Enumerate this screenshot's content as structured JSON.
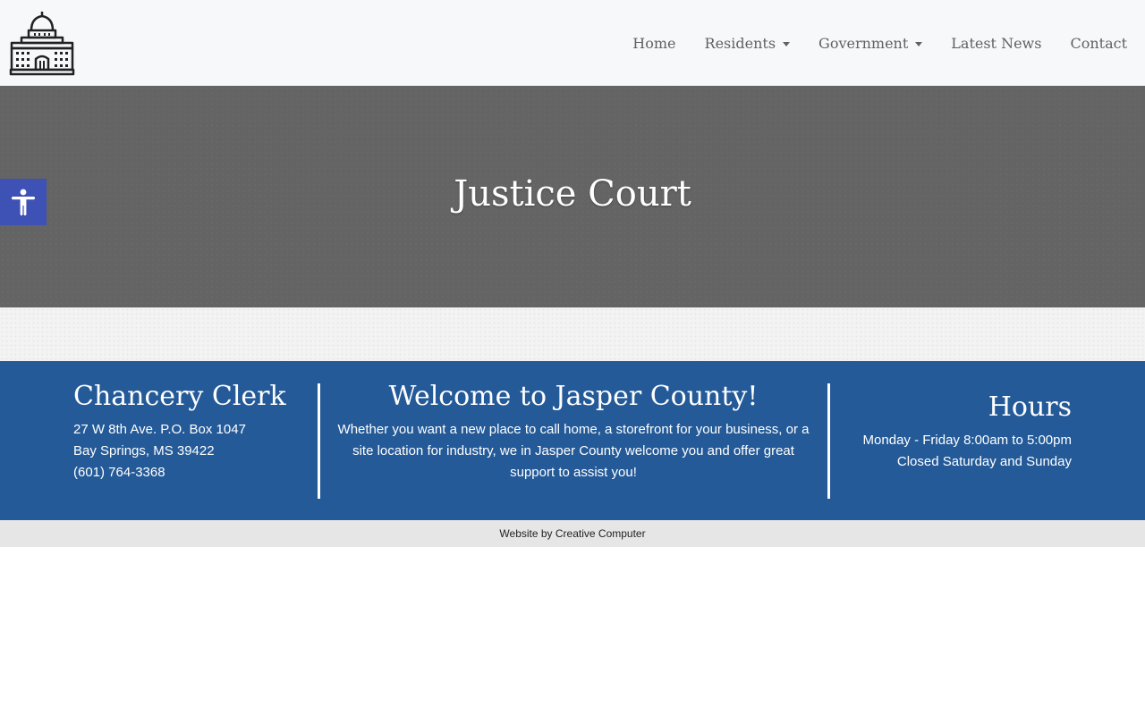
{
  "header": {
    "logo_icon": "courthouse-icon",
    "nav": [
      {
        "label": "Home",
        "dropdown": false
      },
      {
        "label": "Residents",
        "dropdown": true
      },
      {
        "label": "Government",
        "dropdown": true
      },
      {
        "label": "Latest News",
        "dropdown": false
      },
      {
        "label": "Contact",
        "dropdown": false
      }
    ]
  },
  "hero": {
    "title": "Justice Court"
  },
  "accessibility": {
    "icon": "accessibility-icon",
    "color": "#3e51b5"
  },
  "info": {
    "left": {
      "title": "Chancery Clerk",
      "lines": [
        "27 W 8th Ave. P.O. Box 1047",
        "Bay Springs, MS 39422",
        "(601) 764-3368"
      ]
    },
    "middle": {
      "title": "Welcome to Jasper County!",
      "lines": [
        "Whether you want a new place to call home, a storefront for your business, or a",
        "site location for industry, we in Jasper County welcome you and offer great",
        "support to assist you!"
      ]
    },
    "right": {
      "title": "Hours",
      "lines": [
        "Monday - Friday 8:00am to 5:00pm",
        "Closed Saturday and Sunday"
      ]
    },
    "color": "#245a98"
  },
  "credit": {
    "text": "Website by Creative Computer"
  }
}
